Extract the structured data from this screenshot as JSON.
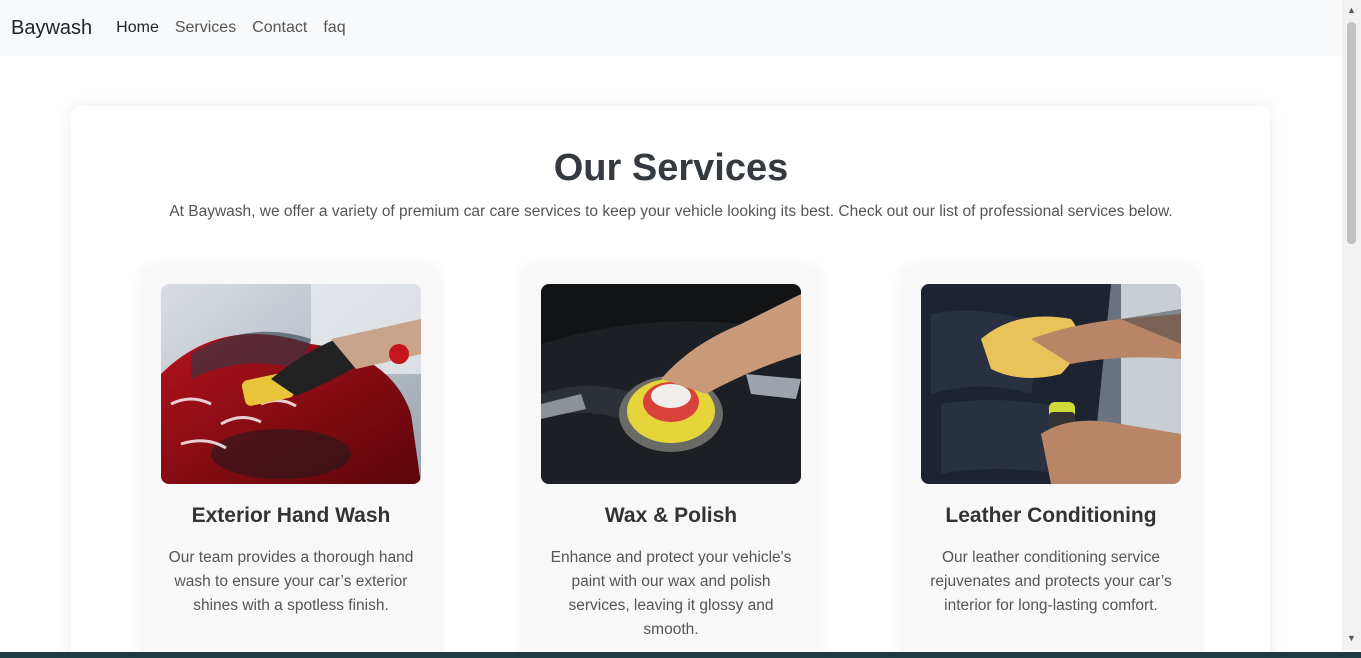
{
  "nav": {
    "brand": "Baywash",
    "links": [
      "Home",
      "Services",
      "Contact",
      "faq"
    ]
  },
  "page": {
    "title": "Our Services",
    "intro": "At Baywash, we offer a variety of premium car care services to keep your vehicle looking its best. Check out our list of professional services below."
  },
  "services": [
    {
      "name": "Exterior Hand Wash",
      "description": "Our team provides a thorough hand wash to ensure your car’s exterior shines with a spotless finish."
    },
    {
      "name": "Wax & Polish",
      "description": "Enhance and protect your vehicle's paint with our wax and polish services, leaving it glossy and smooth."
    },
    {
      "name": "Leather Conditioning",
      "description": "Our leather conditioning service rejuvenates and protects your car’s interior for long-lasting comfort."
    }
  ],
  "colors": {
    "navbar_bg": "#f8f9fa",
    "card_bg": "#f8f8f8",
    "title": "#343a40"
  }
}
